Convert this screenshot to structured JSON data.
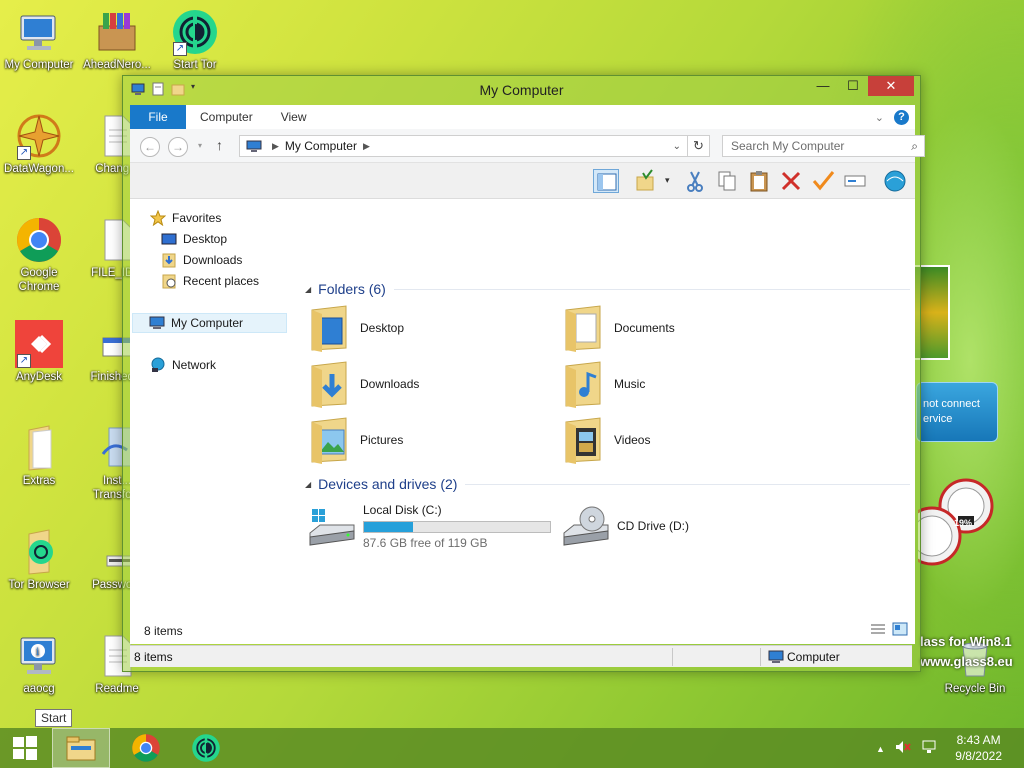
{
  "desktop": {
    "icons": [
      {
        "label": "My Computer",
        "icon": "monitor-icon"
      },
      {
        "label": "AheadNero...",
        "icon": "nero-box-icon"
      },
      {
        "label": "Start Tor",
        "icon": "tor-icon"
      },
      {
        "label": "DataWagon...",
        "icon": "datawagon-icon"
      },
      {
        "label": "Chang...",
        "icon": "document-icon"
      },
      {
        "label": "Google Chrome",
        "icon": "chrome-icon"
      },
      {
        "label": "FILE_ID...",
        "icon": "document-icon"
      },
      {
        "label": "AnyDesk",
        "icon": "anydesk-icon"
      },
      {
        "label": "Finished...",
        "icon": "window-screenshot-icon"
      },
      {
        "label": "Extras",
        "icon": "folder-icon"
      },
      {
        "label": "Inst... Transfo...",
        "icon": "installer-icon"
      },
      {
        "label": "Tor Browser",
        "icon": "tor-folder-icon"
      },
      {
        "label": "Passwo...",
        "icon": "password-file-icon"
      },
      {
        "label": "aaocg",
        "icon": "info-monitor-icon"
      },
      {
        "label": "Readme",
        "icon": "document-icon"
      },
      {
        "label": "Recycle Bin",
        "icon": "recycle-bin-icon"
      }
    ]
  },
  "window": {
    "title": "My Computer",
    "controls": {
      "minimize": "—",
      "maximize": "☐",
      "close": "✕"
    },
    "ribbon_tabs": [
      "File",
      "Computer",
      "View"
    ],
    "address": {
      "location": "My Computer",
      "search_placeholder": "Search My Computer"
    },
    "nav_pane": {
      "favorites": "Favorites",
      "favorites_items": [
        "Desktop",
        "Downloads",
        "Recent places"
      ],
      "computer": "My Computer",
      "network": "Network"
    },
    "folders_header": "Folders (6)",
    "folders": [
      {
        "name": "Desktop",
        "icon": "desktop-folder-icon"
      },
      {
        "name": "Documents",
        "icon": "documents-folder-icon"
      },
      {
        "name": "Downloads",
        "icon": "downloads-folder-icon"
      },
      {
        "name": "Music",
        "icon": "music-folder-icon"
      },
      {
        "name": "Pictures",
        "icon": "pictures-folder-icon"
      },
      {
        "name": "Videos",
        "icon": "videos-folder-icon"
      }
    ],
    "devices_header": "Devices and drives (2)",
    "drives": [
      {
        "name": "Local Disk (C:)",
        "free_text": "87.6 GB free of 119 GB",
        "used_fraction": 0.264,
        "icon": "hard-drive-icon"
      },
      {
        "name": "CD Drive (D:)",
        "icon": "cd-drive-icon"
      }
    ],
    "status_items": "8 items",
    "outer_status_items": "8 items",
    "outer_status_location": "Computer"
  },
  "gadgets": {
    "weather_text": "not connect ervice",
    "meter_value": "19%",
    "glass_line1": "lass for Win8.1",
    "glass_line2": "www.glass8.eu"
  },
  "taskbar": {
    "tooltip": "Start",
    "time": "8:43 AM",
    "date": "9/8/2022"
  },
  "colors": {
    "accent": "#1979ca",
    "close_button": "#c7403a",
    "drive_bar": "#26a0da",
    "taskbar": "#5a8c23"
  }
}
